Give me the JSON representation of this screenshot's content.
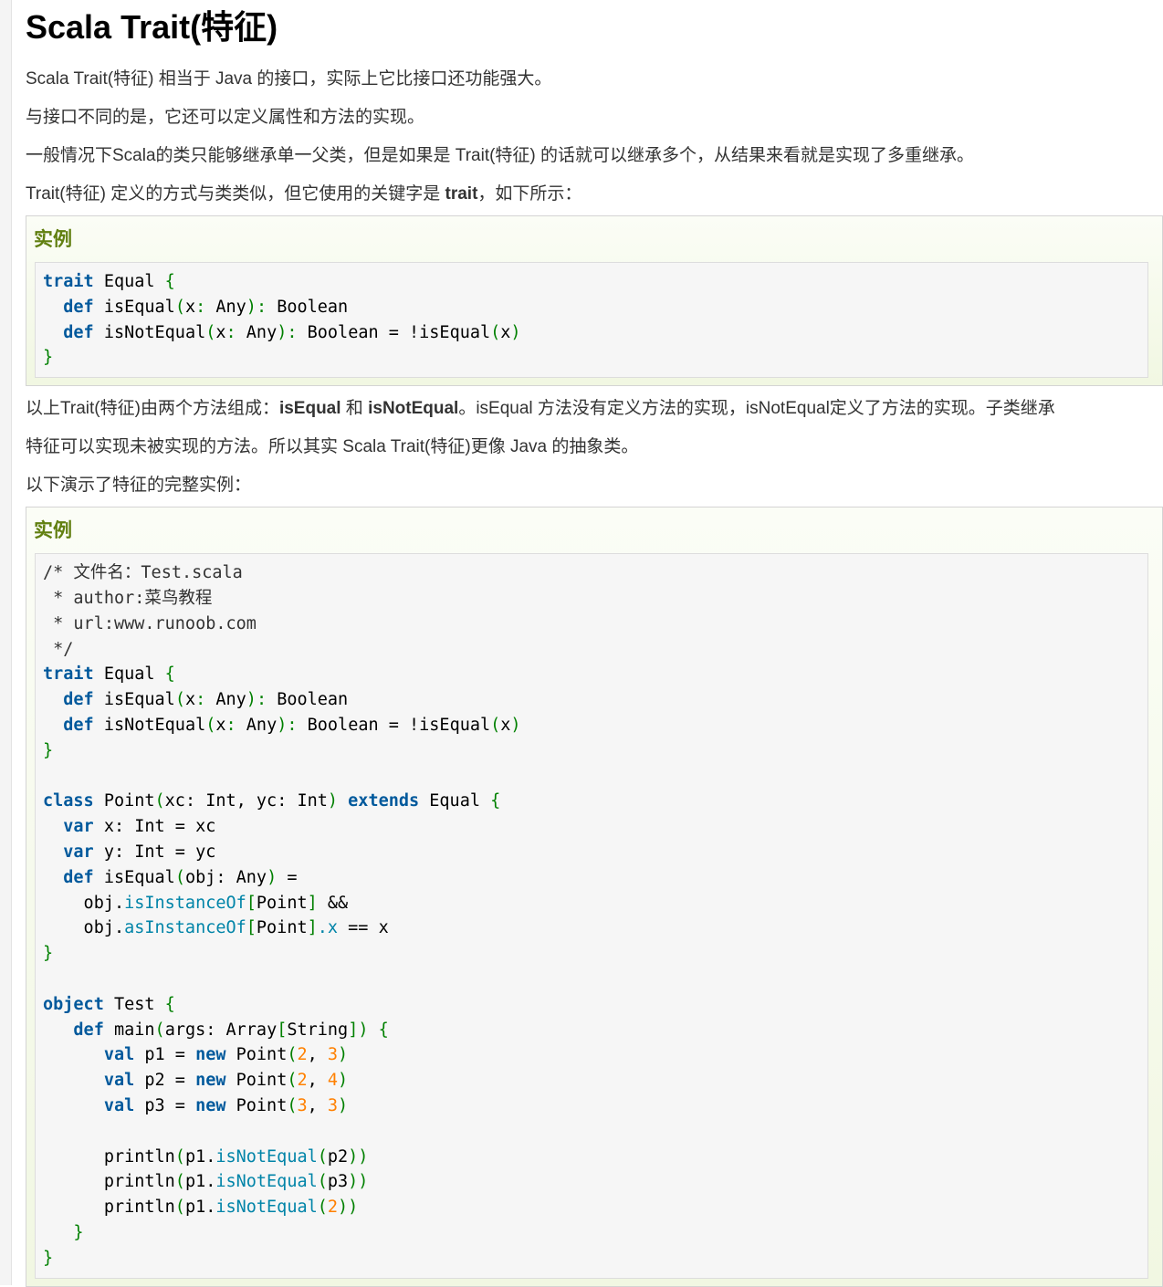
{
  "page_title": "Scala Trait(特征)",
  "intro": [
    "Scala Trait(特征) 相当于 Java 的接口，实际上它比接口还功能强大。",
    "与接口不同的是，它还可以定义属性和方法的实现。",
    "一般情况下Scala的类只能够继承单一父类，但是如果是 Trait(特征) 的话就可以继承多个，从结果来看就是实现了多重继承。"
  ],
  "define_text": {
    "before": "Trait(特征) 定义的方式与类类似，但它使用的关键字是 ",
    "keyword": "trait",
    "after": "，如下所示："
  },
  "example_label": "实例",
  "explain1": {
    "before": "以上Trait(特征)由两个方法组成：",
    "m1": "isEqual",
    "mid": " 和 ",
    "m2": "isNotEqual",
    "after": "。isEqual 方法没有定义方法的实现，isNotEqual定义了方法的实现。子类继承"
  },
  "explain2": "特征可以实现未被实现的方法。所以其实 Scala Trait(特征)更像 Java 的抽象类。",
  "explain3": "以下演示了特征的完整实例：",
  "code1": {
    "l1_kw": "trait",
    "l1_name": " Equal ",
    "l1_br": "{",
    "l2_kw": "def",
    "l2_a": " isEqual",
    "l2_b": "(",
    "l2_c": "x",
    "l2_d": ":",
    "l2_e": " Any",
    "l2_f": ")",
    "l2_g": ":",
    "l2_h": " Boolean",
    "l3_kw": "def",
    "l3_a": " isNotEqual",
    "l3_b": "(",
    "l3_c": "x",
    "l3_d": ":",
    "l3_e": " Any",
    "l3_f": ")",
    "l3_g": ":",
    "l3_h": " Boolean = !isEqual",
    "l3_i": "(",
    "l3_j": "x",
    "l3_k": ")",
    "l4_br": "}"
  },
  "code2": {
    "c1": "/* 文件名：Test.scala",
    "c2": " * author:菜鸟教程",
    "c3": " * url:www.runoob.com",
    "c4": " */",
    "class_kw": "class",
    "class_sig": " Point",
    "class_params": "xc: Int, yc: Int",
    "extends_kw": "extends",
    "var_kw": "var",
    "x_decl": " x: Int = xc",
    "y_decl": " y: Int = yc",
    "obj_line1": "    obj.",
    "is_inst": "isInstanceOf",
    "as_inst": "asInstanceOf",
    "point": "Point",
    "and": "&&",
    "object_kw": "object",
    "test": " Test ",
    "main": " main",
    "args": "args: Array",
    "string": "String",
    "val_kw": "val",
    "new_kw": "new",
    "p1": " p1 = ",
    "p2": " p2 = ",
    "p3": " p3 = ",
    "n2": "2",
    "n3": "3",
    "n4": "4",
    "println": "println",
    "isNotEqual": "isNotEqual"
  }
}
